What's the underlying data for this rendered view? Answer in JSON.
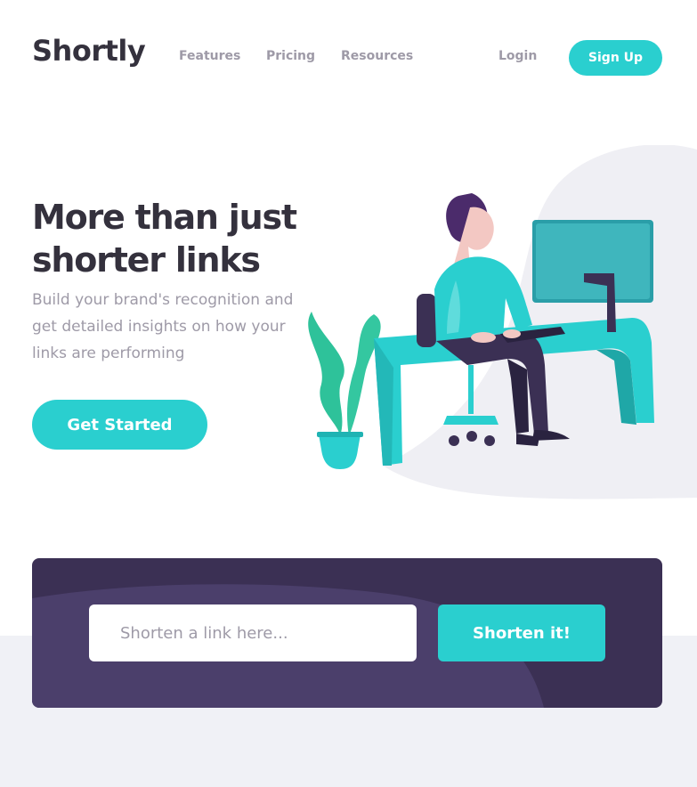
{
  "brand": {
    "name": "Shortly"
  },
  "nav": {
    "items": [
      {
        "label": "Features"
      },
      {
        "label": "Pricing"
      },
      {
        "label": "Resources"
      }
    ],
    "login_label": "Login",
    "signup_label": "Sign Up"
  },
  "hero": {
    "title": "More than just shorter links",
    "subtitle": "Build your brand's recognition and get detailed insights on how your links are performing",
    "cta_label": "Get Started"
  },
  "shorten": {
    "placeholder": "Shorten a link here...",
    "button_label": "Shorten it!"
  },
  "colors": {
    "primary": "#2acfcf",
    "dark_violet": "#3b3054",
    "grayish_violet": "#9e9aa7",
    "very_dark_blue": "#34313d",
    "light_gray": "#f0f1f6"
  }
}
